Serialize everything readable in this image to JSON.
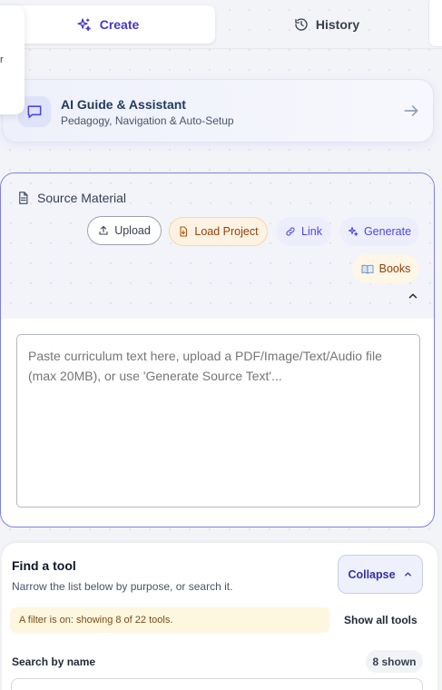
{
  "tabs": {
    "create_label": "Create",
    "history_label": "History"
  },
  "side_fragment": "r",
  "ai_guide": {
    "title": "AI Guide & Assistant",
    "subtitle": "Pedagogy, Navigation & Auto-Setup",
    "icon": "chat-bubble-icon"
  },
  "source": {
    "title": "Source Material",
    "buttons": {
      "upload": "Upload",
      "load_project": "Load Project",
      "link": "Link",
      "generate": "Generate",
      "books": "Books"
    },
    "textarea_placeholder": "Paste curriculum text here, upload a PDF/Image/Text/Audio file (max 20MB), or use 'Generate Source Text'..."
  },
  "tools": {
    "title": "Find a tool",
    "subtitle": "Narrow the list below by purpose, or search it.",
    "collapse_label": "Collapse",
    "filter_note": "A filter is on: showing 8 of 22 tools.",
    "show_all_label": "Show all tools",
    "search_label": "Search by name",
    "shown_count": "8 shown"
  },
  "colors": {
    "accent": "#4f46e5",
    "accent_dark": "#4338ca",
    "border_accent": "#7c7fe0",
    "warm_chip": "#fef3e2",
    "filter_bg": "#fef7e0"
  }
}
